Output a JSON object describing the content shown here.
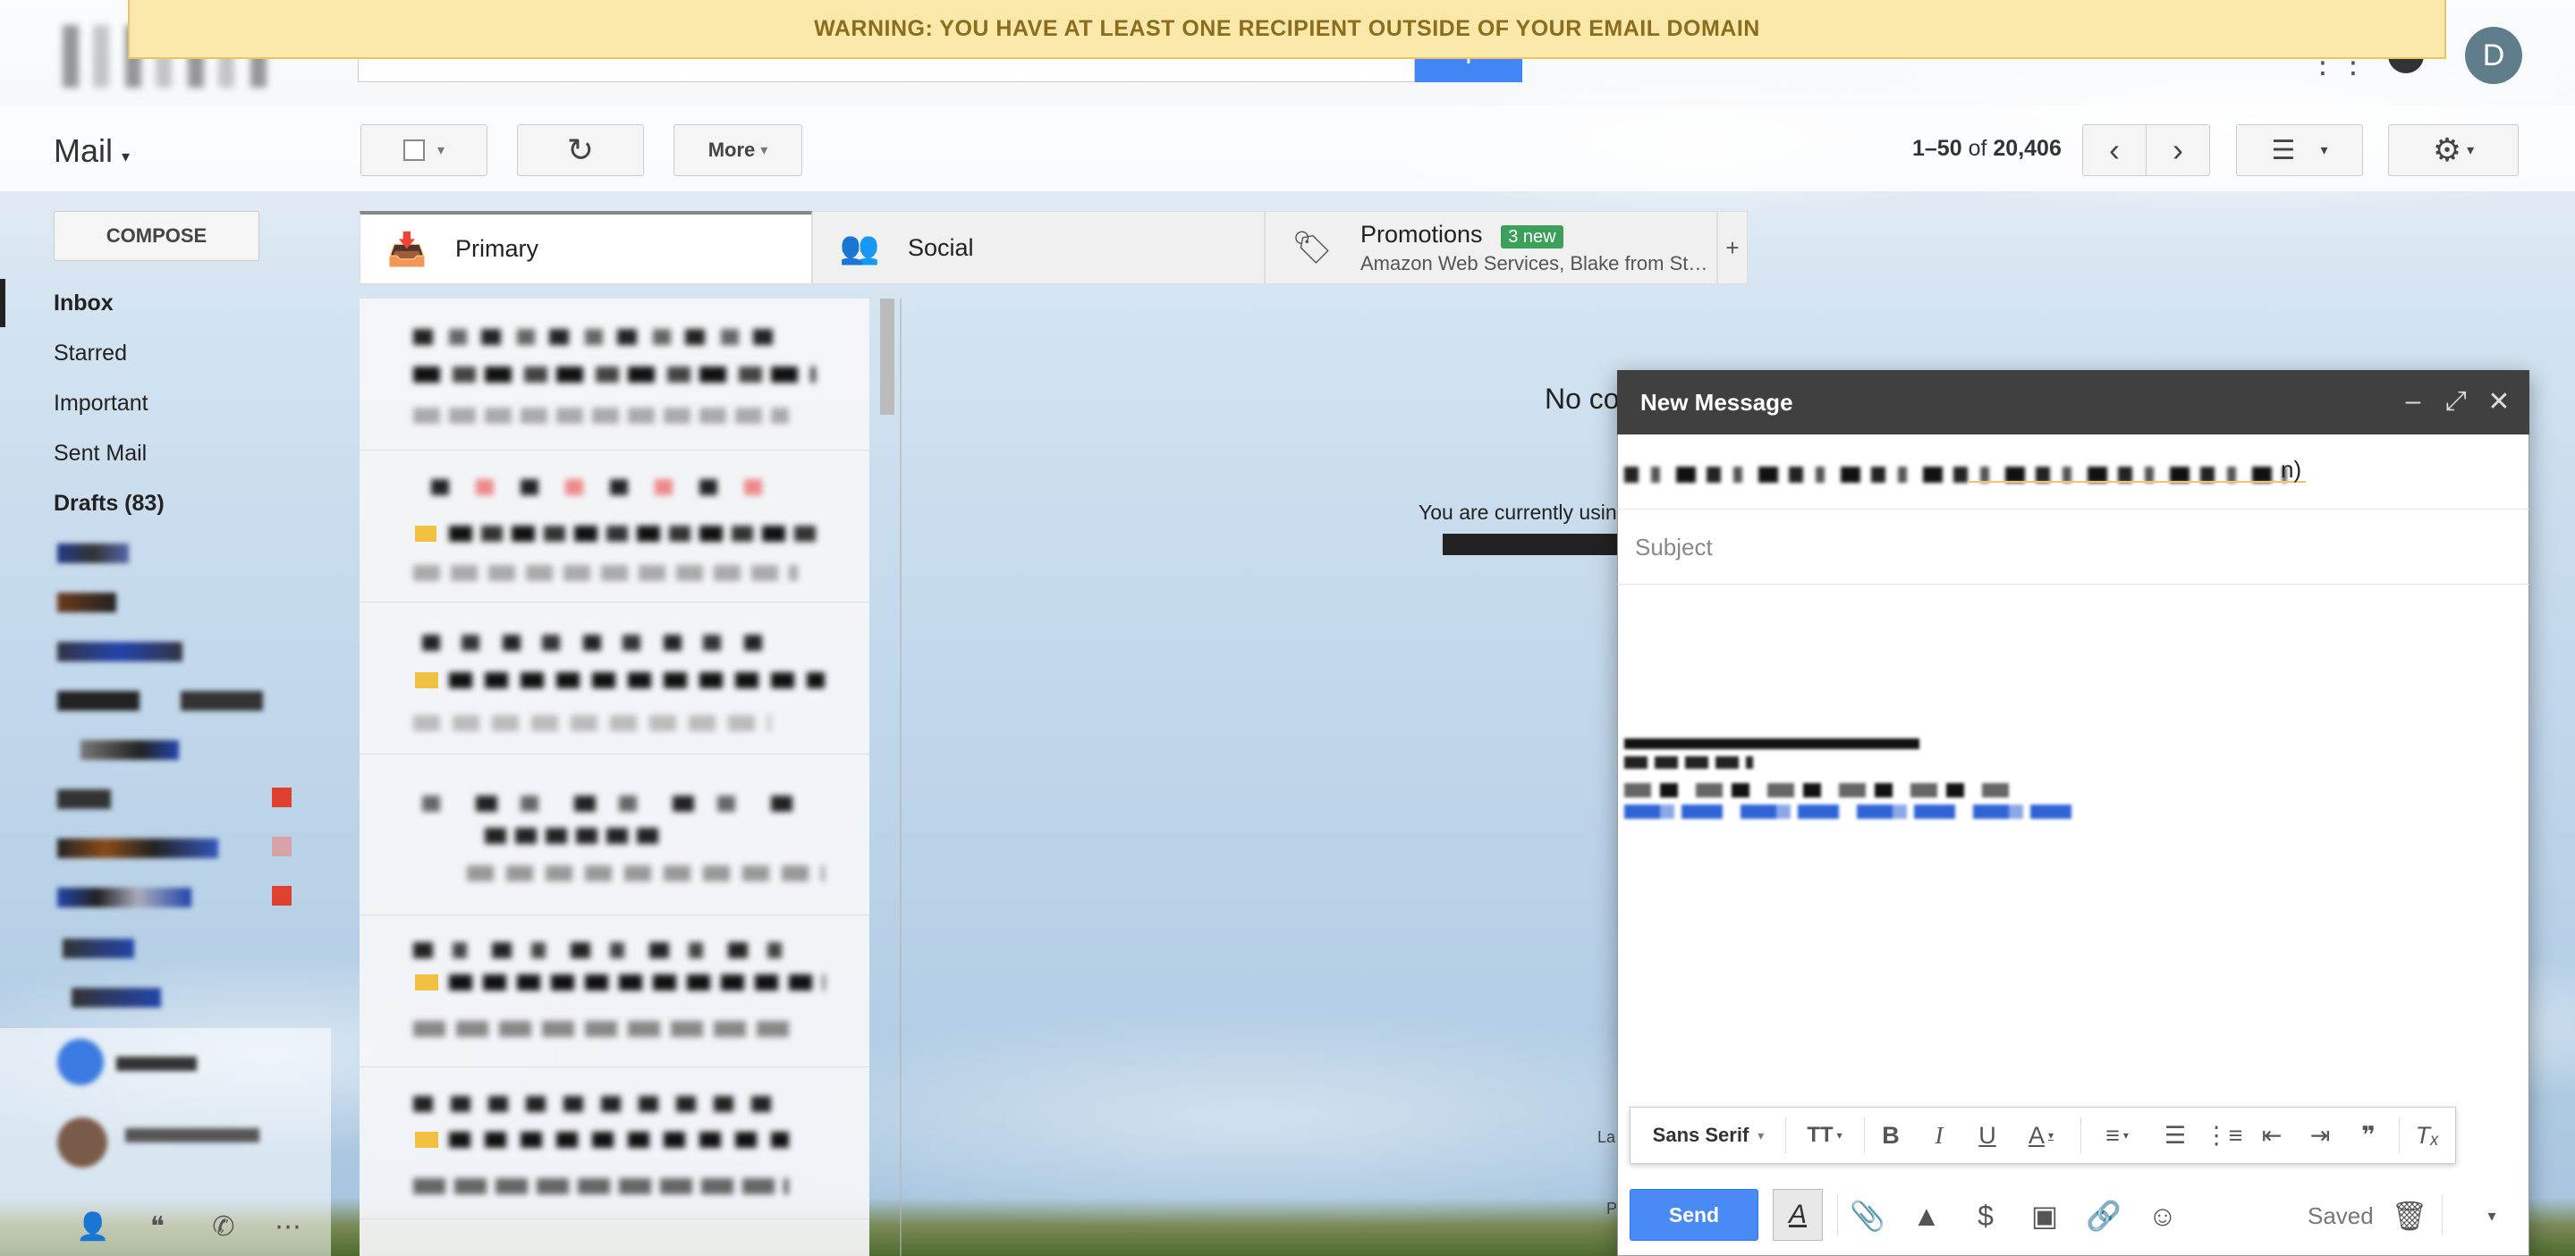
{
  "warning": {
    "text": "WARNING: YOU HAVE AT LEAST ONE RECIPIENT OUTSIDE OF YOUR EMAIL DOMAIN"
  },
  "account": {
    "avatar_letter": "D"
  },
  "toolbar": {
    "mail_label": "Mail",
    "more_label": "More",
    "page_range": "1–50",
    "page_of": "of",
    "page_total": "20,406"
  },
  "sidebar": {
    "compose_label": "COMPOSE",
    "items": [
      {
        "label": "Inbox"
      },
      {
        "label": "Starred"
      },
      {
        "label": "Important"
      },
      {
        "label": "Sent Mail"
      },
      {
        "label": "Drafts (83)"
      }
    ]
  },
  "tabs": [
    {
      "label": "Primary",
      "icon": "inbox-icon"
    },
    {
      "label": "Social",
      "icon": "people-icon"
    },
    {
      "label": "Promotions",
      "icon": "tag-icon",
      "badge": "3 new",
      "subtitle": "Amazon Web Services, Blake from St…"
    }
  ],
  "reading_pane": {
    "no_conversation": "No co",
    "currently_using": "You are currently using",
    "last_activity": "La",
    "details": "P"
  },
  "compose": {
    "title": "New Message",
    "to_tail": "n)",
    "subject_placeholder": "Subject",
    "font_name": "Sans Serif",
    "send_label": "Send",
    "saved_label": "Saved"
  },
  "colors": {
    "warning_bg": "#f9e8a9",
    "warning_text": "#8a6d1e",
    "send_blue": "#4a8af4",
    "promo_badge": "#3ca05b",
    "compose_header": "#404040",
    "label_red": "#e0412f"
  }
}
